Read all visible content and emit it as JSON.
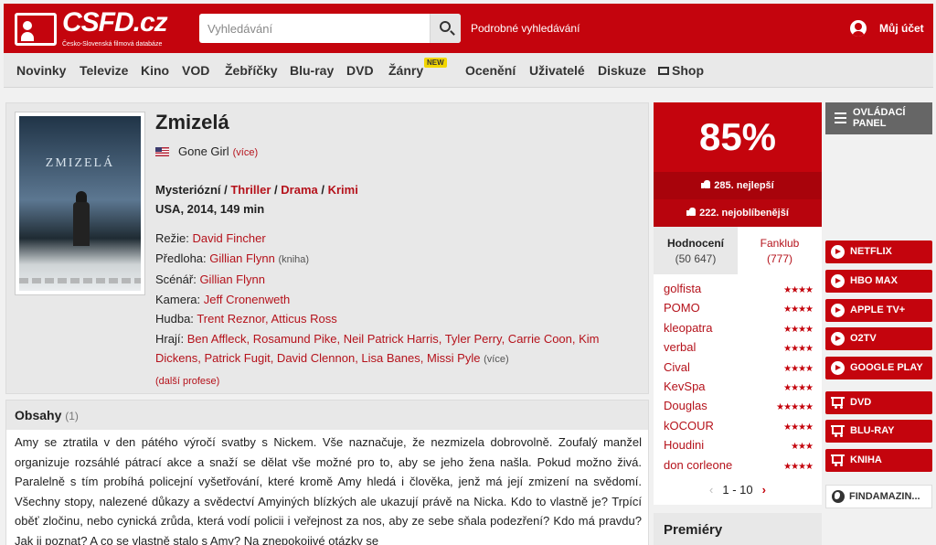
{
  "header": {
    "logo_text": "CSFD.cz",
    "logo_tagline": "Česko-Slovenská filmová databáze",
    "search_placeholder": "Vyhledávání",
    "advanced_search": "Podrobné vyhledávání",
    "account": "Můj účet"
  },
  "nav": {
    "items": [
      "Novinky",
      "Televize",
      "Kino",
      "VOD",
      "Žebříčky",
      "Blu-ray",
      "DVD",
      "Žánry",
      "Ocenění",
      "Uživatelé",
      "Diskuze",
      "Shop"
    ],
    "new_badge": "NEW"
  },
  "film": {
    "poster_title": "ZMIZELÁ",
    "title": "Zmizelá",
    "original_title": "Gone Girl",
    "original_more": "(více)",
    "genres": [
      {
        "label": "Mysteriózní",
        "link": false
      },
      {
        "label": "Thriller",
        "link": true
      },
      {
        "label": "Drama",
        "link": true
      },
      {
        "label": "Krimi",
        "link": true
      }
    ],
    "origin": "USA, 2014, 149 min",
    "credits": {
      "directing_label": "Režie:",
      "director": "David Fincher",
      "source_label": "Předloha:",
      "source": "Gillian Flynn",
      "source_type": "(kniha)",
      "screenplay_label": "Scénář:",
      "screenplay": "Gillian Flynn",
      "camera_label": "Kamera:",
      "camera": "Jeff Cronenweth",
      "music_label": "Hudba:",
      "music": "Trent Reznor, Atticus Ross",
      "cast_label": "Hrají:",
      "cast": "Ben Affleck, Rosamund Pike, Neil Patrick Harris, Tyler Perry, Carrie Coon, Kim Dickens, Patrick Fugit, David Clennon, Lisa Banes, Missi Pyle",
      "cast_more": "(více)",
      "more_professions": "(další profese)"
    }
  },
  "synopsis": {
    "heading": "Obsahy",
    "count": "(1)",
    "text": "Amy se ztratila v den pátého výročí svatby s Nickem. Vše naznačuje, že nezmizela dobrovolně. Zoufalý manžel organizuje rozsáhlé pátrací akce a snaží se dělat vše možné pro to, aby se jeho žena našla. Pokud možno živá. Paralelně s tím probíhá policejní vyšetřování, které kromě Amy hledá i člověka, jenž má její zmizení na svědomí. Všechny stopy, nalezené důkazy a svědectví Amyiných blízkých ale ukazují právě na Nicka. Kdo to vlastně je? Trpící oběť zločinu, nebo cynická zrůda, která vodí policii i veřejnost za nos, aby ze sebe sňala podezření? Kdo má pravdu? Jak ji poznat? A co se vlastně stalo s Amy? Na znepokojivé otázky se"
  },
  "rating": {
    "score": "85%",
    "rank_best": "285. nejlepší",
    "rank_favorite": "222. nejoblíbenější",
    "tab_ratings": "Hodnocení",
    "tab_ratings_count": "(50 647)",
    "tab_fanclub": "Fanklub",
    "tab_fanclub_count": "(777)",
    "users": [
      {
        "name": "golfista",
        "stars": "★★★★"
      },
      {
        "name": "POMO",
        "stars": "★★★★"
      },
      {
        "name": "kleopatra",
        "stars": "★★★★"
      },
      {
        "name": "verbal",
        "stars": "★★★★"
      },
      {
        "name": "Cival",
        "stars": "★★★★"
      },
      {
        "name": "KevSpa",
        "stars": "★★★★"
      },
      {
        "name": "Douglas",
        "stars": "★★★★★"
      },
      {
        "name": "kOCOUR",
        "stars": "★★★★"
      },
      {
        "name": "Houdini",
        "stars": "★★★"
      },
      {
        "name": "don corleone",
        "stars": "★★★★"
      }
    ],
    "pager": "1 - 10",
    "pager_prev": "‹",
    "pager_next": "›"
  },
  "premiery": "Premiéry",
  "sidebar": {
    "control_panel": "OVLÁDACÍ PANEL",
    "services": [
      "NETFLIX",
      "HBO MAX",
      "APPLE TV+",
      "O2TV",
      "GOOGLE PLAY"
    ],
    "shops": [
      "DVD",
      "BLU-RAY",
      "KNIHA"
    ],
    "findamazing": "FINDAMAZIN..."
  },
  "colors": {
    "brand_red": "#c4040d",
    "link_red": "#b5121b",
    "new_badge": "#f2d600"
  }
}
